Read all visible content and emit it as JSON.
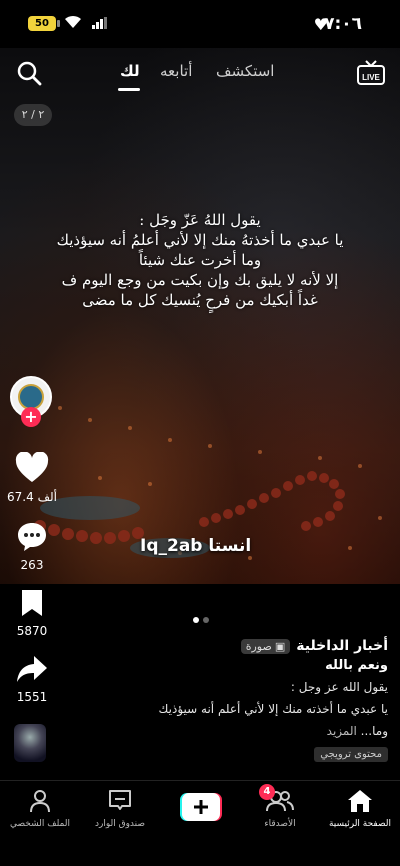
{
  "status_bar": {
    "time": "٧:٠٦",
    "battery": "50"
  },
  "top_nav": {
    "tabs": [
      {
        "label": "لك",
        "active": true
      },
      {
        "label": "أتابعه",
        "active": false
      },
      {
        "label": "استكشف",
        "active": false
      }
    ],
    "live_label": "LIVE"
  },
  "page_counter": "٢ / ٢",
  "overlay": {
    "lines": [
      "يقول اللهُ عَزّ وجَل :",
      "يا عبدي ما أخذتهُ منك إلا لأني أعلمُ أنه سيؤذيك",
      "وما أخرت عنك شيئاً",
      "إلا لأنه لا يليق بك وإن بكيت من وجع اليوم ف",
      "غداً أبكيك من فرحٍ يُنسيك كل ما مضى"
    ],
    "watermark": "انستا Iq_2ab"
  },
  "actions": {
    "likes": "67.4 ألف",
    "comments": "263",
    "saves": "5870",
    "shares": "1551"
  },
  "caption": {
    "author": "أخبار الداخلية",
    "badge": "صورة",
    "title": "ونعم بالله",
    "lines": [
      "يقول الله عز وجل :",
      "يا عبدي ما أخذته منك إلا لأني أعلم أنه سيؤذيك"
    ],
    "last_line": "وما...",
    "more": "المزيد",
    "promo": "محتوى ترويجي"
  },
  "bottom_nav": {
    "home": "الصفحة الرئيسية",
    "friends": "الأصدقاء",
    "friends_badge": "4",
    "inbox": "صندوق الوارد",
    "profile": "الملف الشخصي"
  },
  "colors": {
    "accent": "#fe2c55",
    "cyan": "#25f4ee",
    "battery": "#f2d33c"
  }
}
